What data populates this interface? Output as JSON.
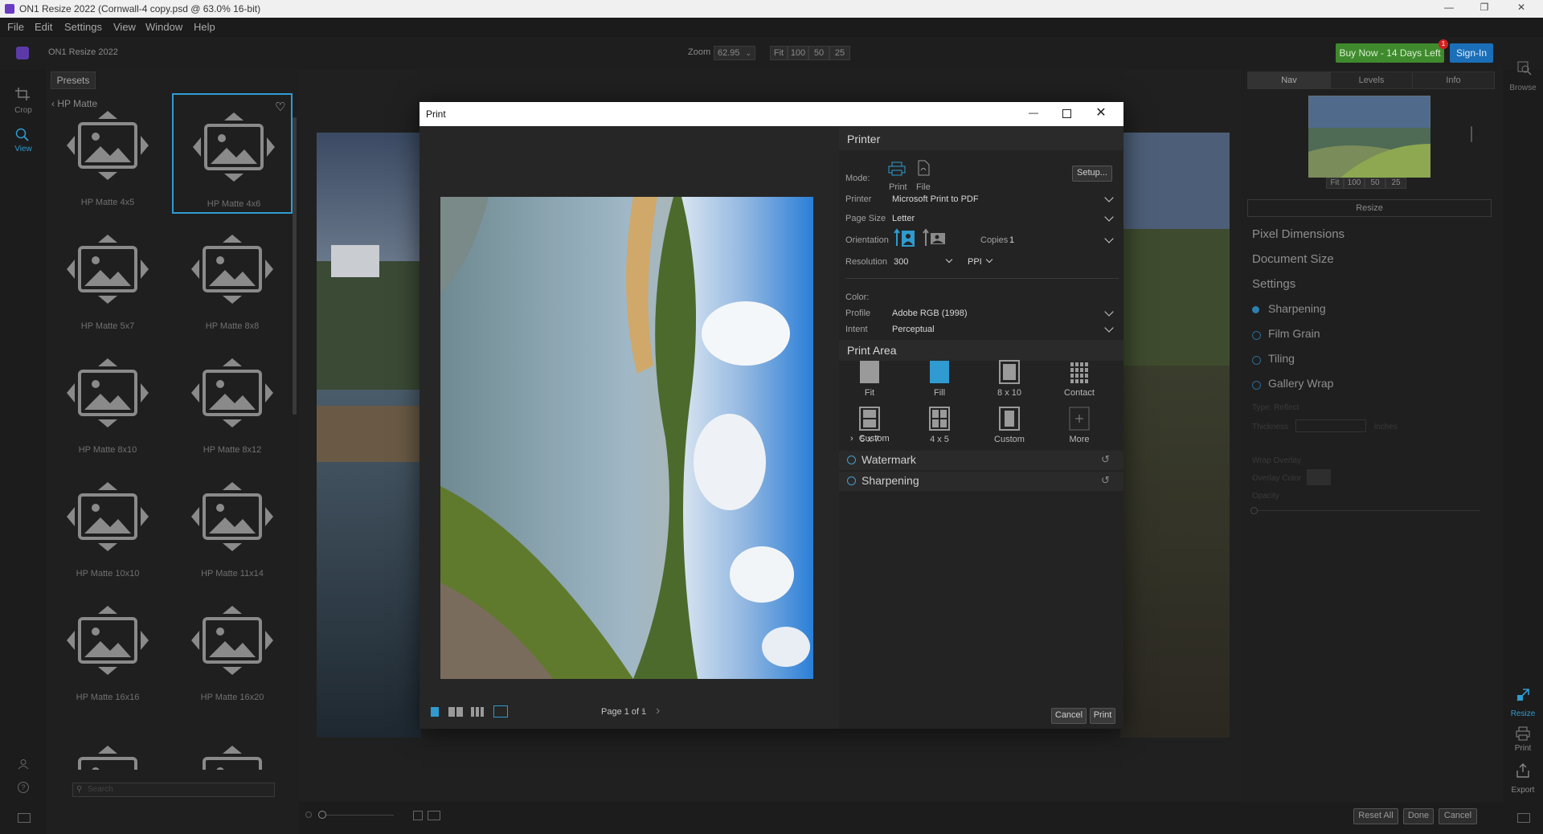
{
  "window": {
    "title": "ON1 Resize 2022 (Cornwall-4 copy.psd @ 63.0% 16-bit)"
  },
  "menu": [
    "File",
    "Edit",
    "Settings",
    "View",
    "Window",
    "Help"
  ],
  "toolbar": {
    "app_name": "ON1 Resize 2022",
    "zoom_label": "Zoom",
    "zoom_value": "62.95",
    "zoom_presets": [
      "Fit",
      "100",
      "50",
      "25"
    ],
    "buy_now": "Buy Now - 14 Days Left",
    "notification_count": "1",
    "sign_in": "Sign-In"
  },
  "tools": {
    "crop": "Crop",
    "view": "View",
    "browse": "Browse"
  },
  "presets": {
    "tab_label": "Presets",
    "breadcrumb": "HP Matte",
    "items": [
      "HP Matte 4x5",
      "HP Matte 4x6",
      "HP Matte 5x7",
      "HP Matte 8x8",
      "HP Matte 8x10",
      "HP Matte 8x12",
      "HP Matte 10x10",
      "HP Matte 11x14",
      "HP Matte 16x16",
      "HP Matte 16x20"
    ],
    "search_placeholder": "Search"
  },
  "right_panel": {
    "tabs": [
      "Nav",
      "Levels",
      "Info"
    ],
    "nav_zoom": [
      "Fit",
      "100",
      "50",
      "25"
    ],
    "resize_label": "Resize",
    "sections": [
      "Pixel Dimensions",
      "Document Size",
      "Settings",
      "Sharpening",
      "Film Grain",
      "Tiling",
      "Gallery Wrap"
    ],
    "faint_type": "Type: Reflect",
    "faint_thickness": "Thickness",
    "faint_inches": "inches",
    "faint_wrap_overlay": "Wrap Overlay",
    "faint_overlay_color": "Overlay Color",
    "faint_opacity": "Opacity"
  },
  "right_strip": {
    "resize": "Resize",
    "print": "Print",
    "export": "Export"
  },
  "bottom": {
    "reset_all": "Reset All",
    "done": "Done",
    "cancel": "Cancel"
  },
  "dialog": {
    "title": "Print",
    "page_indicator": "Page 1 of 1",
    "cancel": "Cancel",
    "print": "Print",
    "printer_section": "Printer",
    "mode_label": "Mode:",
    "mode_print": "Print",
    "mode_file": "File",
    "setup": "Setup...",
    "printer_label": "Printer",
    "printer_value": "Microsoft Print to PDF",
    "page_size_label": "Page Size",
    "page_size_value": "Letter",
    "orientation_label": "Orientation",
    "copies_label": "Copies",
    "copies_value": "1",
    "resolution_label": "Resolution",
    "resolution_value": "300",
    "resolution_unit": "PPI",
    "color_label": "Color:",
    "profile_label": "Profile",
    "profile_value": "Adobe RGB (1998)",
    "intent_label": "Intent",
    "intent_value": "Perceptual",
    "print_area_section": "Print Area",
    "print_area_items": [
      "Fit",
      "Fill",
      "8 x 10",
      "Contact",
      "5 x 7",
      "4 x 5",
      "Custom",
      "More"
    ],
    "custom_row": "Custom",
    "watermark": "Watermark",
    "sharpening": "Sharpening"
  },
  "colors": {
    "accent": "#2f9bd0",
    "buy_green": "#3f8a2d",
    "sign_in_blue": "#1b6fb8"
  }
}
